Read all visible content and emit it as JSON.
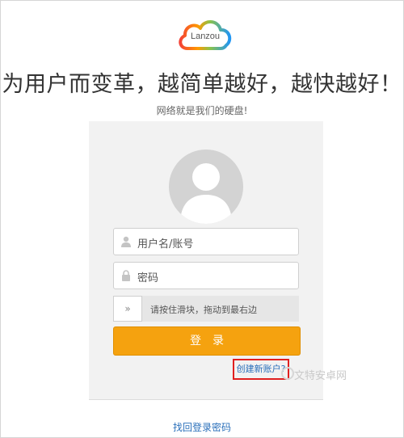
{
  "brand": {
    "logo_text": "Lanzou"
  },
  "header": {
    "slogan": "为用户而变革，越简单越好，越快越好！",
    "subtitle": "网络就是我们的硬盘!"
  },
  "login": {
    "username_placeholder": "用户名/账号",
    "password_placeholder": "密码",
    "slider_hint": "请按住滑块，拖动到最右边",
    "slider_handle": "»",
    "submit_label": "登录",
    "create_account": "创建新账户?",
    "forgot_password": "找回登录密码"
  },
  "watermark": {
    "text": "文特安卓网"
  },
  "colors": {
    "button": "#f5a20f",
    "link": "#2a6fba",
    "highlight": "#e02020"
  }
}
